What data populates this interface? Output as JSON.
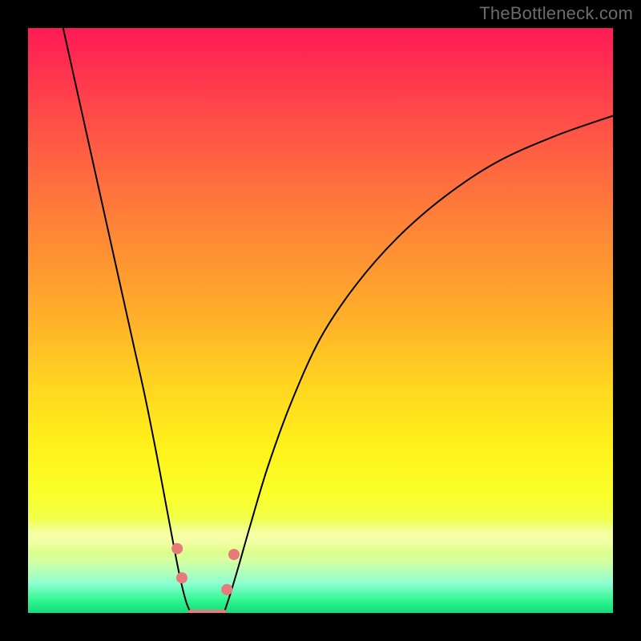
{
  "watermark": "TheBottleneck.com",
  "colors": {
    "gradient_top": "#ff1a55",
    "gradient_mid": "#ffd81f",
    "gradient_bottom": "#15d97d",
    "curve": "#000000",
    "marker": "#e97a7a",
    "frame": "#000000"
  },
  "chart_data": {
    "type": "line",
    "title": "",
    "xlabel": "",
    "ylabel": "",
    "xlim": [
      0,
      100
    ],
    "ylim": [
      0,
      100
    ],
    "grid": false,
    "legend": false,
    "series": [
      {
        "name": "left-branch",
        "x": [
          6,
          8,
          10,
          12,
          14,
          16,
          18,
          20,
          22,
          23.5,
          25,
          26,
          27,
          27.8
        ],
        "y": [
          100,
          91,
          82,
          73,
          64,
          55,
          46,
          37,
          27,
          19,
          11,
          6,
          2,
          0
        ]
      },
      {
        "name": "right-branch",
        "x": [
          33.5,
          34.5,
          36,
          38,
          41,
          45,
          50,
          56,
          63,
          71,
          80,
          90,
          100
        ],
        "y": [
          0,
          3,
          8,
          15,
          25,
          36,
          47,
          56,
          64,
          71,
          77,
          81.5,
          85
        ]
      },
      {
        "name": "trough-flat",
        "x": [
          27.8,
          29,
          30,
          31,
          32,
          33.5
        ],
        "y": [
          0,
          0,
          0,
          0,
          0,
          0
        ]
      }
    ],
    "markers": [
      {
        "name": "dot-left-upper",
        "x": 25.5,
        "y": 11
      },
      {
        "name": "dot-left-lower",
        "x": 26.3,
        "y": 6
      },
      {
        "name": "dot-right-lower",
        "x": 34.0,
        "y": 4
      },
      {
        "name": "dot-right-upper",
        "x": 35.2,
        "y": 10
      }
    ]
  }
}
